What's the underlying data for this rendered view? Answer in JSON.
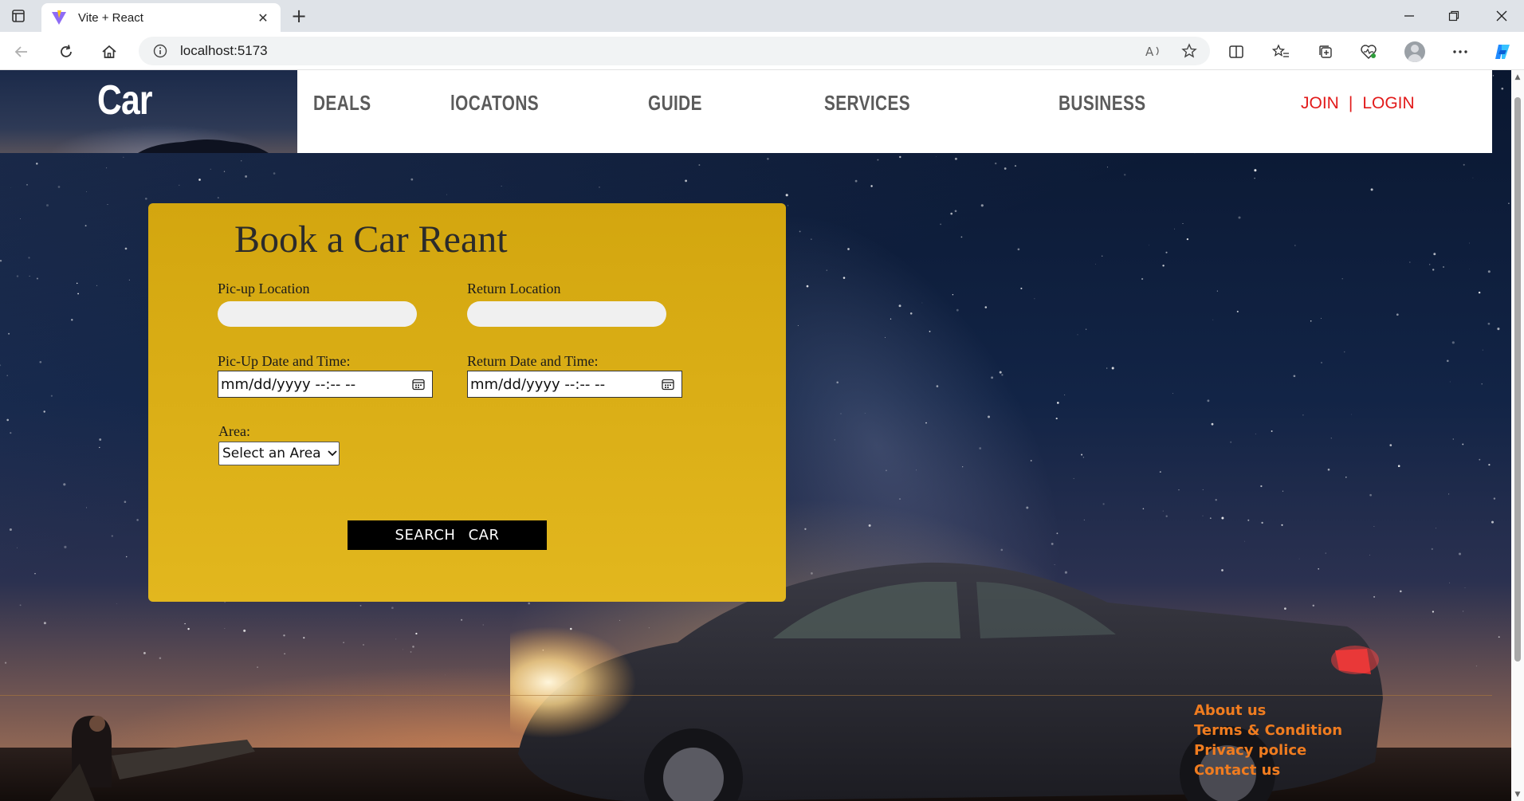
{
  "browser": {
    "tab_title": "Vite + React",
    "url": "localhost:5173"
  },
  "site": {
    "logo": "Car",
    "nav": [
      {
        "label": "DEALS"
      },
      {
        "label": "lOCATONS"
      },
      {
        "label": "GUIDE"
      },
      {
        "label": "SERVICES"
      },
      {
        "label": "BUSINESS"
      }
    ],
    "join": "JOIN",
    "separator": "|",
    "login": "LOGIN"
  },
  "booking": {
    "title": "Book a Car Reant",
    "pickup_location_label": "Pic-up Location",
    "pickup_location_value": "",
    "return_location_label": "Return Location",
    "return_location_value": "",
    "pickup_datetime_label": "Pic-Up Date and Time:",
    "pickup_datetime_value": "mm/dd/yyyy --:-- --",
    "return_datetime_label": "Return Date and Time:",
    "return_datetime_value": "mm/dd/yyyy --:-- --",
    "area_label": "Area:",
    "area_selected": "Select an Area",
    "search_button": "SEARCH CAR"
  },
  "footer": {
    "links": [
      {
        "label": "About us"
      },
      {
        "label": "Terms & Condition"
      },
      {
        "label": "Privacy police"
      },
      {
        "label": "Contact us"
      }
    ]
  },
  "colors": {
    "card": "#d8ab14",
    "nav_text": "#5b5b5b",
    "auth_text": "#e21a1a",
    "footer_link": "#f07c1f"
  }
}
